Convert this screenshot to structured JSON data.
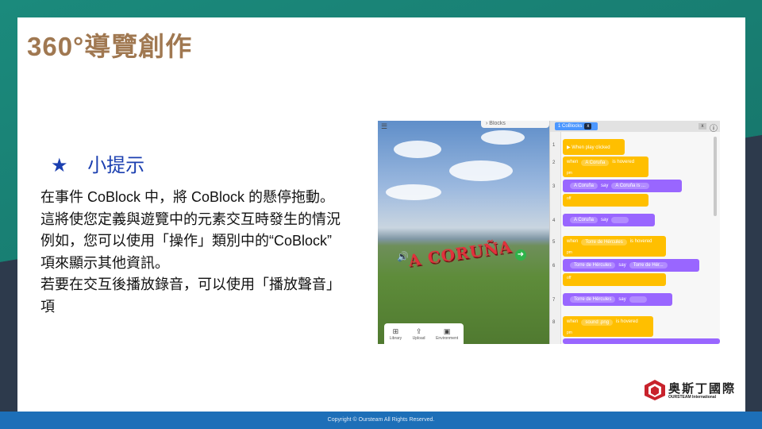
{
  "slide": {
    "title": "360°導覽創作",
    "tip_star": "★",
    "tip_label": "小提示",
    "body_lines": [
      "在事件 CoBlock  中，將 CoBlock 的懸停拖動。",
      "這將使您定義與遊覽中的元素交互時發生的情況",
      "例如，您可以使用「操作」類別中的“CoBlock”",
      "項來顯示其他資訊。",
      "若要在交互後播放錄音，可以使用「播放聲音」",
      "項"
    ]
  },
  "screenshot": {
    "scene_menu_icon": "menu-icon",
    "blocks_tab": "Blocks",
    "scene_text": "A CORUÑA",
    "toolbar": [
      {
        "icon": "library-icon",
        "glyph": "⊞",
        "label": "Library"
      },
      {
        "icon": "upload-icon",
        "glyph": "⇪",
        "label": "Upload"
      },
      {
        "icon": "environment-icon",
        "glyph": "▣",
        "label": "Environment"
      }
    ],
    "editor_tab": "1  CoBlocks",
    "editor_tab_close": "x",
    "close_btn": "x",
    "info_icon": "ⓘ",
    "lines": [
      {
        "n": "1",
        "parts": [
          "▶ When play clicked"
        ]
      },
      {
        "n": "2",
        "parts": [
          "when",
          "A Coruña",
          "is hovered"
        ],
        "sub": "pm"
      },
      {
        "n": "3",
        "parts": [
          "A Coruña",
          "say",
          "A Coruña is ..."
        ]
      },
      {
        "n": "4",
        "parts": [
          "A Coruña",
          "say",
          ""
        ],
        "sub": "off"
      },
      {
        "n": "5",
        "parts": [
          "when",
          "Torre de Hércules",
          "is hovered"
        ],
        "sub": "pm"
      },
      {
        "n": "6",
        "parts": [
          "Torre de Hércules",
          "say",
          "Torre de Hér..."
        ]
      },
      {
        "n": "7",
        "parts": [
          "Torre de Hércules",
          "say",
          ""
        ],
        "sub": "off"
      },
      {
        "n": "8",
        "parts": [
          "when",
          "sound .png",
          "is hovered"
        ],
        "sub": "pm"
      }
    ]
  },
  "logo": {
    "name_cn": "奥斯丁國際",
    "name_en": "OURSTEAM International"
  },
  "footer": {
    "copyright": "Copyright © Oursteam All Rights Reserved."
  },
  "colors": {
    "title": "#a07851",
    "tip": "#1b3fb0",
    "footer": "#1d6fb8",
    "event_block": "#ffbf00",
    "looks_block": "#9966ff"
  }
}
